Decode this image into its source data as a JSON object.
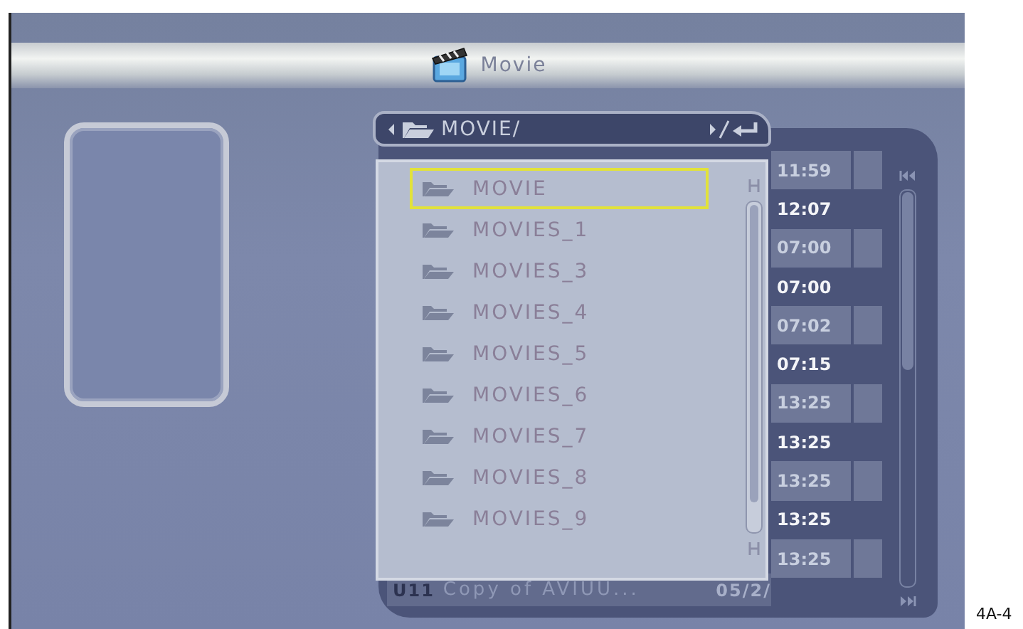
{
  "header": {
    "title": "Movie"
  },
  "path_bar": {
    "path": "MOVIE/"
  },
  "files": [
    {
      "name": "MOVIE",
      "selected": true
    },
    {
      "name": "MOVIES_1",
      "selected": false
    },
    {
      "name": "MOVIES_3",
      "selected": false
    },
    {
      "name": "MOVIES_4",
      "selected": false
    },
    {
      "name": "MOVIES_5",
      "selected": false
    },
    {
      "name": "MOVIES_6",
      "selected": false
    },
    {
      "name": "MOVIES_7",
      "selected": false
    },
    {
      "name": "MOVIES_8",
      "selected": false
    },
    {
      "name": "MOVIES_9",
      "selected": false
    }
  ],
  "details_row": {
    "index": "U11",
    "name": "Copy of AVIUU...",
    "date": "05/2/"
  },
  "times": [
    "11:59",
    "12:07",
    "07:00",
    "07:00",
    "07:02",
    "07:15",
    "13:25",
    "13:25",
    "13:25",
    "13:25",
    "13:25"
  ],
  "caption": "4A-4"
}
